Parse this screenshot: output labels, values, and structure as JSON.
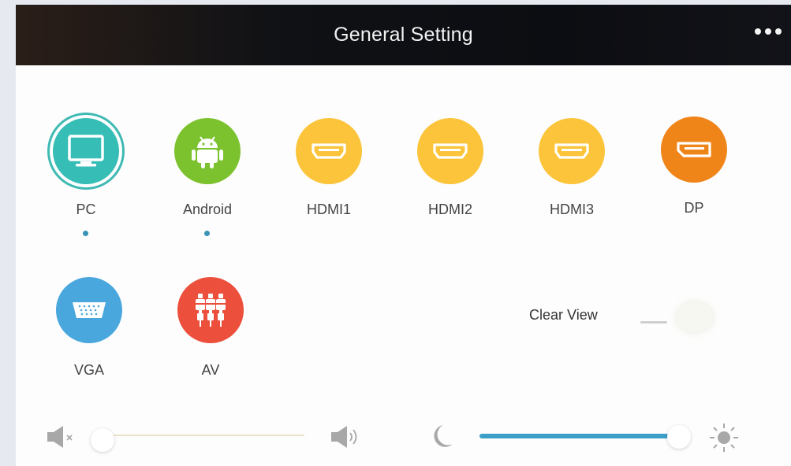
{
  "header": {
    "title": "General Setting",
    "menu_icon": "more-dots-icon"
  },
  "sources": [
    {
      "label": "PC",
      "icon": "monitor-icon",
      "color": "#35bdb6",
      "selected": true,
      "has_signal": true
    },
    {
      "label": "Android",
      "icon": "android-icon",
      "color": "#7cc22e",
      "selected": false,
      "has_signal": true
    },
    {
      "label": "HDMI1",
      "icon": "hdmi-icon",
      "color": "#fbc43a",
      "selected": false,
      "has_signal": false
    },
    {
      "label": "HDMI2",
      "icon": "hdmi-icon",
      "color": "#fbc43a",
      "selected": false,
      "has_signal": false
    },
    {
      "label": "HDMI3",
      "icon": "hdmi-icon",
      "color": "#fbc43a",
      "selected": false,
      "has_signal": false
    },
    {
      "label": "DP",
      "icon": "displayport-icon",
      "color": "#ef8418",
      "selected": false,
      "has_signal": false
    },
    {
      "label": "VGA",
      "icon": "vga-icon",
      "color": "#4aa7de",
      "selected": false,
      "has_signal": false
    },
    {
      "label": "AV",
      "icon": "rca-icon",
      "color": "#ec4f3b",
      "selected": false,
      "has_signal": false
    }
  ],
  "clear_view": {
    "label": "Clear View",
    "enabled": false
  },
  "volume": {
    "value": 0,
    "min_icon": "mute-icon",
    "max_icon": "volume-icon"
  },
  "brightness": {
    "value": 100,
    "min_icon": "moon-icon",
    "max_icon": "sun-icon",
    "accent": "#3aa0c8"
  }
}
